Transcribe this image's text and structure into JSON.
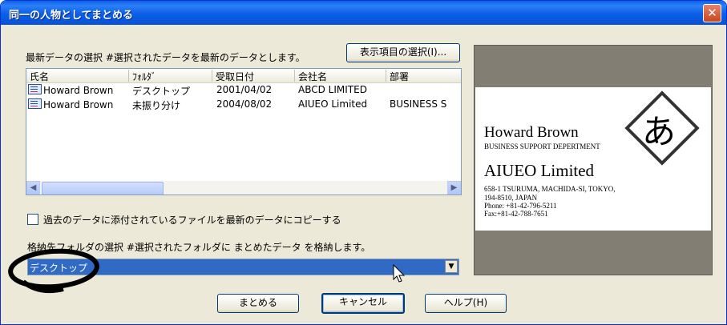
{
  "window": {
    "title": "同一の人物としてまとめる",
    "close_label": "✕"
  },
  "select_latest": {
    "label": "最新データの選択  #選択されたデータを最新のデータとします。",
    "display_items_button": "表示項目の選択(I)..."
  },
  "list": {
    "columns": [
      "氏名",
      "ﾌｫﾙﾀﾞ",
      "受取日付",
      "会社名",
      "部署"
    ],
    "rows": [
      {
        "name": "Howard Brown",
        "folder": "デスクトップ",
        "date": "2001/04/02",
        "company": "ABCD LIMITED",
        "dept": ""
      },
      {
        "name": "Howard Brown",
        "folder": "未振り分け",
        "date": "2004/08/02",
        "company": "AIUEO Limited",
        "dept": "BUSINESS S"
      }
    ]
  },
  "copy_files": {
    "label": "過去のデータに添付されているファイルを最新のデータにコピーする",
    "checked": false
  },
  "dest_folder": {
    "label": "格納先フォルダの選択  #選択されたフォルダに まとめたデータ を格納します。",
    "selected": "デスクトップ"
  },
  "card": {
    "name": "Howard Brown",
    "dept": "BUSINESS SUPPORT DEPERTMENT",
    "company": "AIUEO Limited",
    "addr1": "658-1 TSURUMA, MACHIDA-SI, TOKYO,",
    "addr2": "194-8510,  JAPAN",
    "phone": "Phone: +81-42-796-5211",
    "fax": "Fax:+81-42-788-7651",
    "logo": "あ"
  },
  "buttons": {
    "merge": "まとめる",
    "cancel": "キャンセル",
    "help": "ヘルプ(H)"
  },
  "colors": {
    "titlebar": "#0a5fe6",
    "selection": "#316ac5",
    "dialog_bg": "#ece9d8",
    "annotation": "#000000"
  }
}
